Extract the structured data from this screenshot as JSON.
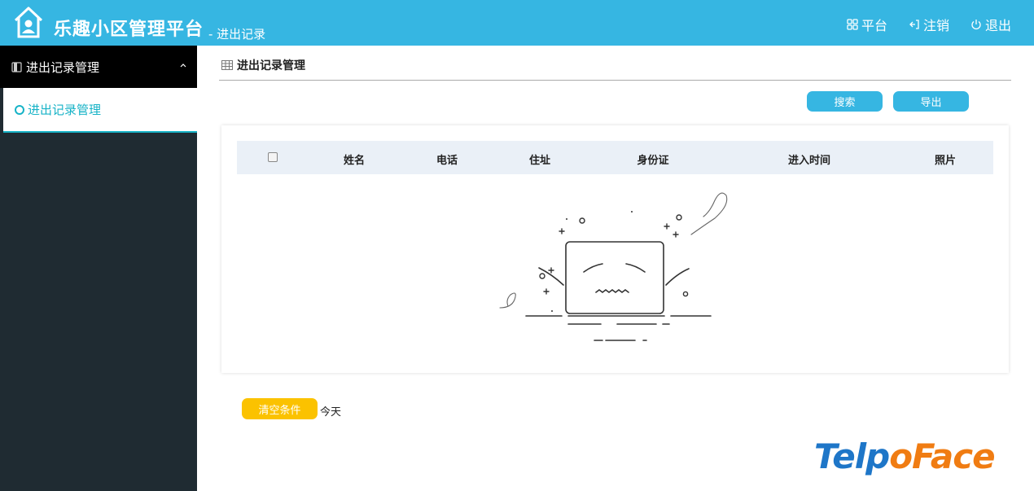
{
  "header": {
    "app_title": "乐趣小区管理平台",
    "subtitle": "- 进出记录",
    "links": [
      {
        "icon": "grid-icon",
        "label": "平台"
      },
      {
        "icon": "logout-icon",
        "label": "注销"
      },
      {
        "icon": "power-icon",
        "label": "退出"
      }
    ]
  },
  "sidebar": {
    "section_title": "进出记录管理",
    "items": [
      {
        "label": "进出记录管理",
        "active": true
      }
    ]
  },
  "main": {
    "page_title": "进出记录管理",
    "buttons": {
      "search": "搜索",
      "export": "导出"
    },
    "table": {
      "columns": [
        "姓名",
        "电话",
        "住址",
        "身份证",
        "进入时间",
        "照片"
      ],
      "rows": []
    },
    "clear_button": "清空条件",
    "date_filter": "今天"
  },
  "brand": {
    "part1": "Telp",
    "part2": "o",
    "part3": "Face"
  },
  "colors": {
    "header": "#36b6e2",
    "sidebar": "#1f2b32",
    "accent": "#17b3c7",
    "clear": "#fbc200",
    "brand_blue": "#1e76c8",
    "brand_orange": "#f07c12"
  }
}
